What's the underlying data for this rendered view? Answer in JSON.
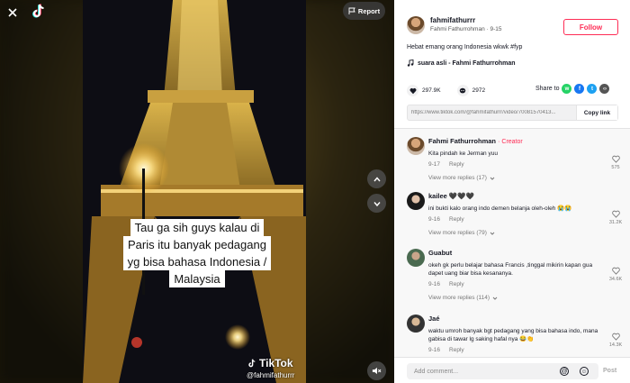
{
  "video": {
    "caption_lines": [
      "Tau ga sih guys kalau di",
      "Paris itu banyak pedagang",
      "yg bisa bahasa Indonesia /",
      "Malaysia"
    ],
    "watermark": "TikTok",
    "handle": "@fahmifathurrr",
    "report_label": "Report",
    "icons": {
      "close": "close-icon",
      "logo": "tiktok-logo-icon",
      "report": "flag-icon",
      "up": "chevron-up-icon",
      "down": "chevron-down-icon",
      "mute": "mute-icon"
    }
  },
  "post": {
    "username": "fahmifathurrr",
    "display_name": "Fahmi Fathurrohman",
    "date": "9-15",
    "follow_label": "Follow",
    "description": "Hebat emang orang Indonesia wkwk #fyp",
    "music": "suara asli - Fahmi Fathurrohman",
    "likes": "297.9K",
    "comments_count": "2972",
    "share_label": "Share to",
    "link": "https://www.tiktok.com/@fahmifathurrr/video/70081570413...",
    "copy_label": "Copy link"
  },
  "comments": [
    {
      "name": "Fahmi Fathurrohman",
      "creator": "· Creator",
      "text": "Kita pindah ke Jerman yuu",
      "date": "9-17",
      "reply": "Reply",
      "likes": "575",
      "more": "View more replies (17)",
      "avatar": "#b07a52"
    },
    {
      "name": "kailee 🖤🖤🖤",
      "creator": "",
      "text": "ini bukti kalo orang indo demen belanja oleh-oleh 😭😭",
      "date": "9-16",
      "reply": "Reply",
      "likes": "31.2K",
      "more": "View more replies (79)",
      "avatar": "#2a2a2a"
    },
    {
      "name": "Guabut",
      "creator": "",
      "text": "okeh gk perlu belajar bahasa Francis ,tinggal mikirin kapan gua dapet uang biar bisa kesananya.",
      "date": "9-16",
      "reply": "Reply",
      "likes": "34.6K",
      "more": "View more replies (114)",
      "avatar": "#5a7a5a"
    },
    {
      "name": "Jaé",
      "creator": "",
      "text": "waktu umroh banyak bgt pedagang yang bisa bahasa indo, mana gabisa di tawar lg saking hafal nya 😂👏",
      "date": "9-16",
      "reply": "Reply",
      "likes": "14.3K",
      "more": "",
      "avatar": "#333333"
    }
  ],
  "comment_bar": {
    "placeholder": "Add comment...",
    "post_label": "Post"
  },
  "colors": {
    "accent": "#fe2c55",
    "whatsapp": "#25d366",
    "facebook": "#1877f2",
    "twitter": "#1da1f2",
    "embed": "#555555"
  }
}
